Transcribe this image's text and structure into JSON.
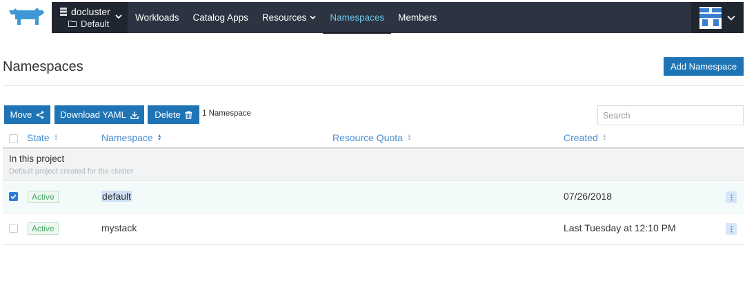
{
  "app": {
    "logo_icon": "rancher-cow-logo",
    "accent": "#1f74b6",
    "nav_bg": "#2b3440"
  },
  "cluster": {
    "name": "docluster",
    "project": "Default"
  },
  "nav": {
    "items": [
      {
        "label": "Workloads"
      },
      {
        "label": "Catalog Apps"
      },
      {
        "label": "Resources"
      },
      {
        "label": "Namespaces"
      },
      {
        "label": "Members"
      }
    ]
  },
  "header": {
    "title": "Namespaces",
    "add_label": "Add Namespace"
  },
  "toolbar": {
    "move_label": "Move",
    "download_label": "Download YAML",
    "delete_label": "Delete",
    "count_text": "1 Namespace",
    "search_placeholder": "Search"
  },
  "table": {
    "columns": [
      "State",
      "Namespace",
      "Resource Quota",
      "Created"
    ],
    "group": {
      "title": "In this project",
      "subtitle": "Default project created for the cluster"
    },
    "rows": [
      {
        "state": "Active",
        "namespace": "default",
        "quota": "",
        "created": "07/26/2018",
        "checked": true
      },
      {
        "state": "Active",
        "namespace": "mystack",
        "quota": "",
        "created": "Last Tuesday at 12:10 PM",
        "checked": false
      }
    ]
  }
}
